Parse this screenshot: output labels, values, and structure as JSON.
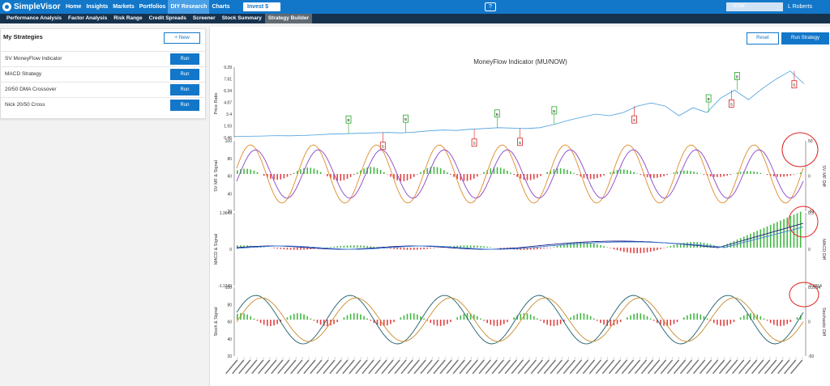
{
  "app": {
    "logo_text": "SimpleVisor"
  },
  "nav": {
    "items": [
      {
        "label": "Home",
        "active": false
      },
      {
        "label": "Insights",
        "active": false
      },
      {
        "label": "Markets",
        "active": false
      },
      {
        "label": "Portfolios",
        "active": false
      },
      {
        "label": "DIY Research",
        "active": true
      },
      {
        "label": "Charts",
        "active": false
      }
    ],
    "invest_label": "Invest $",
    "symbol_value": "NOW",
    "user_name": "L Roberts"
  },
  "subnav": {
    "items": [
      {
        "label": "Performance Analysis",
        "active": false
      },
      {
        "label": "Factor Analysis",
        "active": false
      },
      {
        "label": "Risk Range",
        "active": false
      },
      {
        "label": "Credit Spreads",
        "active": false
      },
      {
        "label": "Screener",
        "active": false
      },
      {
        "label": "Stock Summary",
        "active": false
      },
      {
        "label": "Strategy Builder",
        "active": true
      }
    ]
  },
  "strategies": {
    "title": "My Strategies",
    "new_label": "+ New",
    "run_label": "Run",
    "items": [
      {
        "label": "SV MoneyFlow Indicator"
      },
      {
        "label": "MACD Strategy"
      },
      {
        "label": "20/50 DMA Crossover"
      },
      {
        "label": "Nick 20/50 Cross"
      }
    ]
  },
  "toolbar": {
    "reset_label": "Reset",
    "run_strategy_label": "Run Strategy"
  },
  "colors": {
    "brand": "#1277c9",
    "subnav": "#17324d",
    "buy": "#22aa22",
    "sell": "#dd2222",
    "annotation": "#e02020"
  },
  "chart_data": [
    {
      "type": "line",
      "title": "MoneyFlow Indicator (MU/NOW)",
      "ylabel": "Price Ratio",
      "y_ticks": [
        "9.28",
        "7.81",
        "6.34",
        "4.87",
        "3.4",
        "1.93",
        "0.46"
      ],
      "ylim": [
        0.46,
        9.28
      ],
      "series": [
        {
          "values": [
            0.6,
            0.62,
            0.65,
            0.7,
            0.68,
            0.72,
            0.8,
            0.9,
            0.95,
            1.0,
            1.05,
            1.1,
            1.05,
            1.15,
            1.3,
            1.4,
            1.35,
            1.5,
            1.6,
            1.7,
            1.65,
            1.6,
            1.7,
            2.1,
            2.6,
            3.0,
            3.4,
            3.2,
            3.6,
            4.4,
            4.8,
            4.4,
            3.2,
            4.2,
            3.6,
            5.4,
            6.4,
            5.2,
            6.6,
            7.8,
            8.8,
            7.2
          ]
        }
      ],
      "signals": [
        {
          "type": "B",
          "x": 0.2
        },
        {
          "type": "S",
          "x": 0.26
        },
        {
          "type": "B",
          "x": 0.3
        },
        {
          "type": "S",
          "x": 0.42
        },
        {
          "type": "B",
          "x": 0.46
        },
        {
          "type": "S",
          "x": 0.5
        },
        {
          "type": "B",
          "x": 0.56
        },
        {
          "type": "S",
          "x": 0.7
        },
        {
          "type": "B",
          "x": 0.83
        },
        {
          "type": "S",
          "x": 0.87
        },
        {
          "type": "B",
          "x": 0.88
        },
        {
          "type": "S",
          "x": 0.98
        }
      ]
    },
    {
      "type": "line",
      "ylabel": "SV MF & Signal",
      "ylabel_right": "SV MF Diff",
      "y_ticks": [
        "100",
        "80",
        "60",
        "40",
        "20"
      ],
      "y_ticks_right": [
        "50",
        "0",
        "-50"
      ]
    },
    {
      "type": "line",
      "ylabel": "MACD & Signal",
      "ylabel_right": "MACD Diff",
      "y_ticks": [
        "1.3649",
        "0",
        "-1.1249"
      ],
      "y_ticks_right": [
        "0.3",
        "0",
        "-0.2914"
      ]
    },
    {
      "type": "line",
      "ylabel": "Stoch & Signal",
      "ylabel_right": "Stochastic Diff",
      "y_ticks": [
        "100",
        "80",
        "60",
        "40",
        "20"
      ],
      "y_ticks_right": [
        "0.2914",
        "0",
        "-50"
      ]
    }
  ]
}
